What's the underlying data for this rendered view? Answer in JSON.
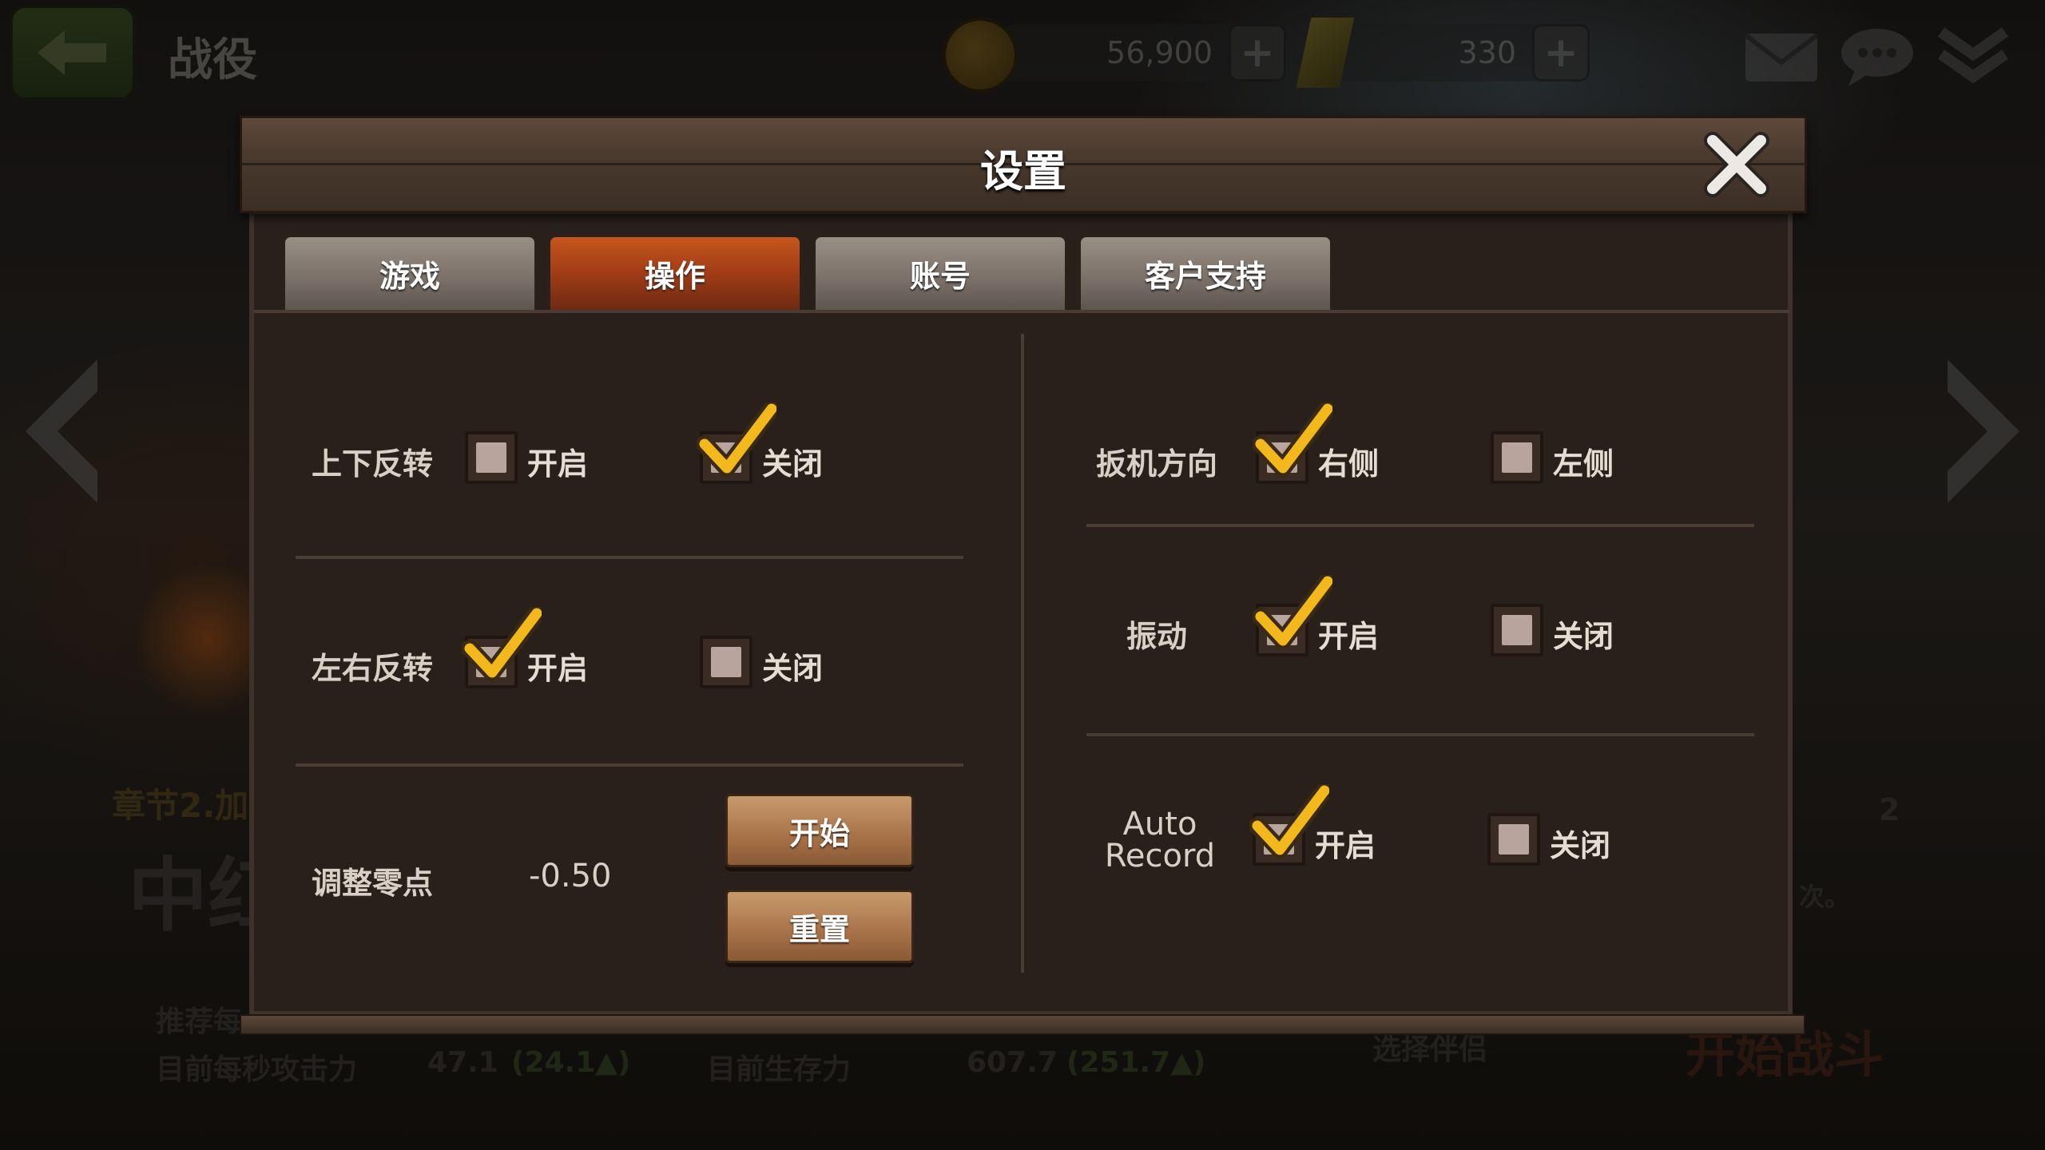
{
  "topbar": {
    "title": "战役",
    "gold": "56,900",
    "gems": "330"
  },
  "background": {
    "chapter_text": "章节2.加",
    "big_text": "中红",
    "recommend_text": "推荐每",
    "attack_label": "目前每秒攻击力",
    "attack_value": "47.1",
    "attack_delta": "(24.1▲)",
    "survival_label": "目前生存力",
    "survival_value": "607.7",
    "survival_delta": "(251.7▲)",
    "select_partner": "选择伴侣",
    "start_battle": "开始战斗",
    "count": "2",
    "times_text": "次。"
  },
  "dialog": {
    "title": "设置",
    "tabs": [
      "游戏",
      "操作",
      "账号",
      "客户支持"
    ],
    "active_tab": "操作"
  },
  "settings": {
    "invert_y": {
      "label": "上下反转",
      "on": "开启",
      "off": "关闭",
      "selected": "off"
    },
    "invert_x": {
      "label": "左右反转",
      "on": "开启",
      "off": "关闭",
      "selected": "on"
    },
    "zero_point": {
      "label": "调整零点",
      "value": "-0.50",
      "start_button": "开始",
      "reset_button": "重置"
    },
    "trigger_side": {
      "label": "扳机方向",
      "right": "右侧",
      "left": "左侧",
      "selected": "right"
    },
    "vibration": {
      "label": "振动",
      "on": "开启",
      "off": "关闭",
      "selected": "on"
    },
    "auto_record": {
      "label_line1": "Auto",
      "label_line2": "Record",
      "on": "开启",
      "off": "关闭",
      "selected": "on"
    }
  },
  "colors": {
    "active_tab": "#a03c16",
    "checkmark": "#f2b81c",
    "panel": "#2a201b"
  }
}
